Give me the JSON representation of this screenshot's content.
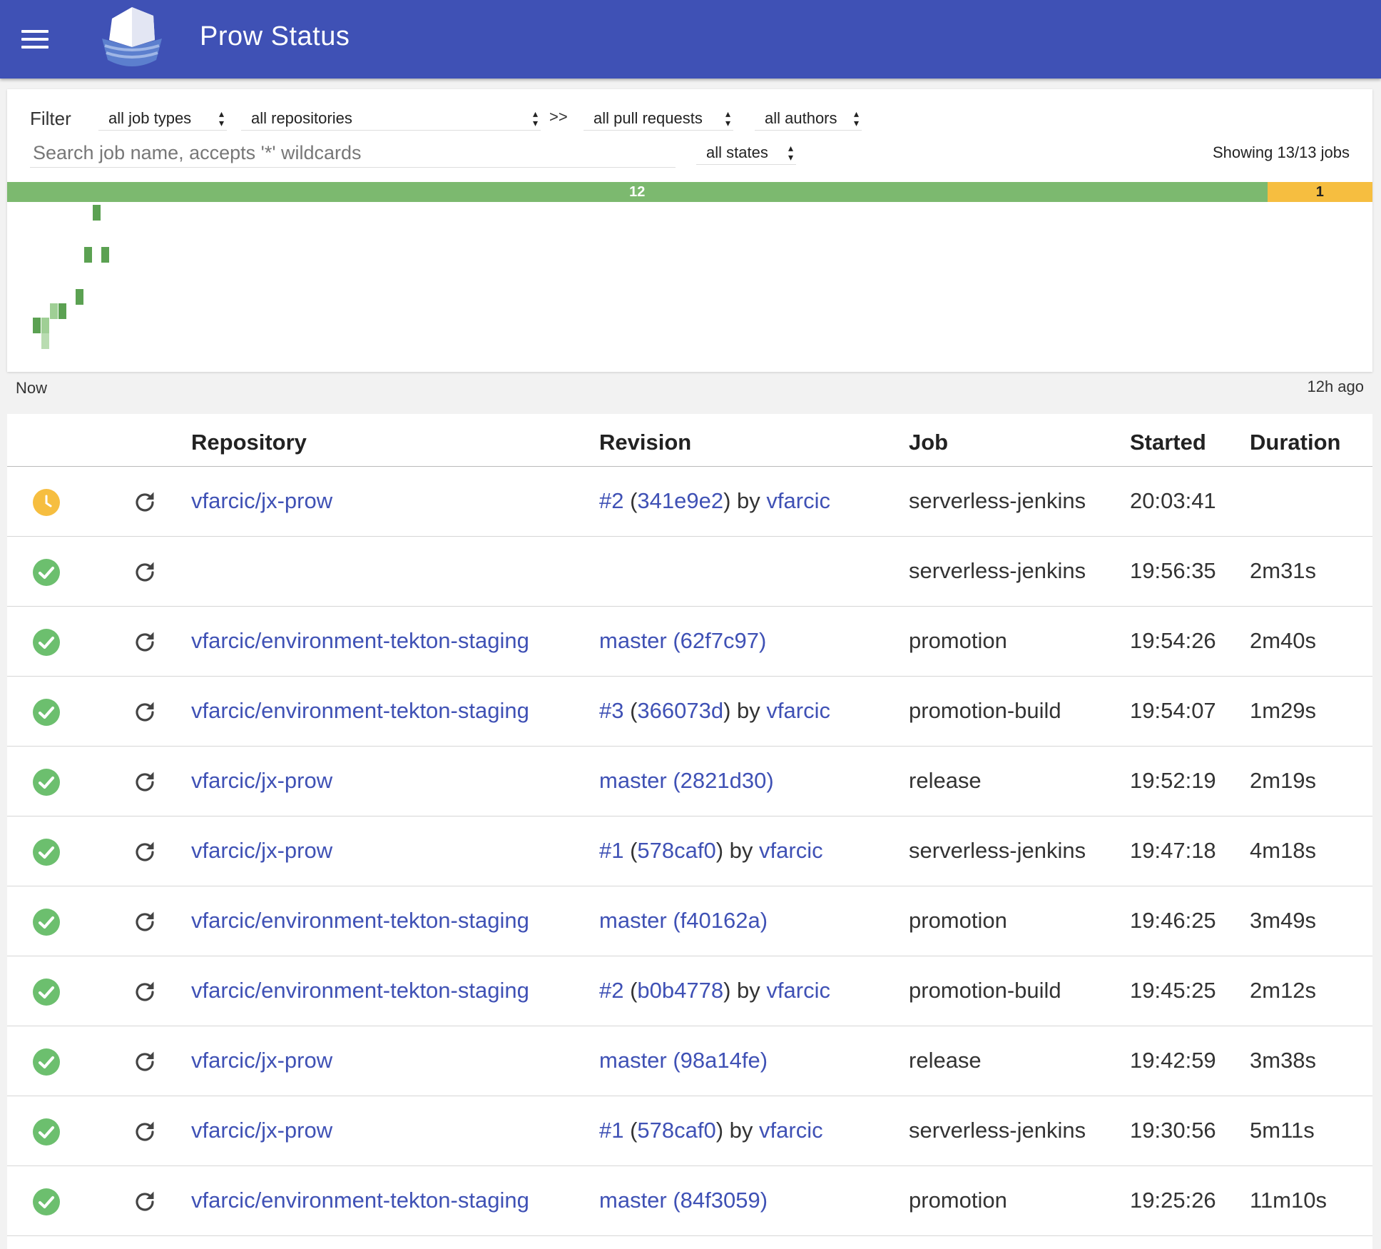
{
  "header": {
    "title": "Prow Status",
    "menu_icon": "hamburger-menu-icon",
    "logo_icon": "prow-ship-logo"
  },
  "filter": {
    "label": "Filter",
    "job_types": "all job types",
    "repositories": "all repositories",
    "separator": ">>",
    "pull_requests": "all pull requests",
    "authors": "all authors",
    "states": "all states",
    "search_placeholder": "Search job name, accepts '*' wildcards",
    "search_value": "",
    "showing": "Showing 13/13 jobs"
  },
  "status_bar": {
    "success_count": "12",
    "pending_count": "1",
    "success_fraction": 0.923,
    "colors": {
      "success": "#7cb96f",
      "pending": "#f6be40"
    }
  },
  "histogram": {
    "left_label": "Now",
    "right_label": "12h ago"
  },
  "table": {
    "headers": {
      "repository": "Repository",
      "revision": "Revision",
      "job": "Job",
      "started": "Started",
      "duration": "Duration"
    },
    "rows": [
      {
        "state": "pending",
        "repo": "vfarcic/jx-prow",
        "rev_pr": "#2",
        "rev_open": " (",
        "rev_sha": "341e9e2",
        "rev_close": ") by ",
        "rev_author": "vfarcic",
        "job": "serverless-jenkins",
        "started": "20:03:41",
        "duration": ""
      },
      {
        "state": "success",
        "repo": "",
        "rev_pr": "",
        "rev_open": "",
        "rev_sha": "",
        "rev_close": "",
        "rev_author": "",
        "job": "serverless-jenkins",
        "started": "19:56:35",
        "duration": "2m31s"
      },
      {
        "state": "success",
        "repo": "vfarcic/environment-tekton-staging",
        "rev_pr": "master (62f7c97)",
        "rev_open": "",
        "rev_sha": "",
        "rev_close": "",
        "rev_author": "",
        "job": "promotion",
        "started": "19:54:26",
        "duration": "2m40s"
      },
      {
        "state": "success",
        "repo": "vfarcic/environment-tekton-staging",
        "rev_pr": "#3",
        "rev_open": " (",
        "rev_sha": "366073d",
        "rev_close": ") by ",
        "rev_author": "vfarcic",
        "job": "promotion-build",
        "started": "19:54:07",
        "duration": "1m29s"
      },
      {
        "state": "success",
        "repo": "vfarcic/jx-prow",
        "rev_pr": "master (2821d30)",
        "rev_open": "",
        "rev_sha": "",
        "rev_close": "",
        "rev_author": "",
        "job": "release",
        "started": "19:52:19",
        "duration": "2m19s"
      },
      {
        "state": "success",
        "repo": "vfarcic/jx-prow",
        "rev_pr": "#1",
        "rev_open": " (",
        "rev_sha": "578caf0",
        "rev_close": ") by ",
        "rev_author": "vfarcic",
        "job": "serverless-jenkins",
        "started": "19:47:18",
        "duration": "4m18s"
      },
      {
        "state": "success",
        "repo": "vfarcic/environment-tekton-staging",
        "rev_pr": "master (f40162a)",
        "rev_open": "",
        "rev_sha": "",
        "rev_close": "",
        "rev_author": "",
        "job": "promotion",
        "started": "19:46:25",
        "duration": "3m49s"
      },
      {
        "state": "success",
        "repo": "vfarcic/environment-tekton-staging",
        "rev_pr": "#2",
        "rev_open": " (",
        "rev_sha": "b0b4778",
        "rev_close": ") by ",
        "rev_author": "vfarcic",
        "job": "promotion-build",
        "started": "19:45:25",
        "duration": "2m12s"
      },
      {
        "state": "success",
        "repo": "vfarcic/jx-prow",
        "rev_pr": "master (98a14fe)",
        "rev_open": "",
        "rev_sha": "",
        "rev_close": "",
        "rev_author": "",
        "job": "release",
        "started": "19:42:59",
        "duration": "3m38s"
      },
      {
        "state": "success",
        "repo": "vfarcic/jx-prow",
        "rev_pr": "#1",
        "rev_open": " (",
        "rev_sha": "578caf0",
        "rev_close": ") by ",
        "rev_author": "vfarcic",
        "job": "serverless-jenkins",
        "started": "19:30:56",
        "duration": "5m11s"
      },
      {
        "state": "success",
        "repo": "vfarcic/environment-tekton-staging",
        "rev_pr": "master (84f3059)",
        "rev_open": "",
        "rev_sha": "",
        "rev_close": "",
        "rev_author": "",
        "job": "promotion",
        "started": "19:25:26",
        "duration": "11m10s"
      }
    ]
  },
  "colors": {
    "header": "#3f51b5",
    "link": "#3f51b5",
    "success": "#6cbf6e",
    "pending": "#f6be40"
  }
}
